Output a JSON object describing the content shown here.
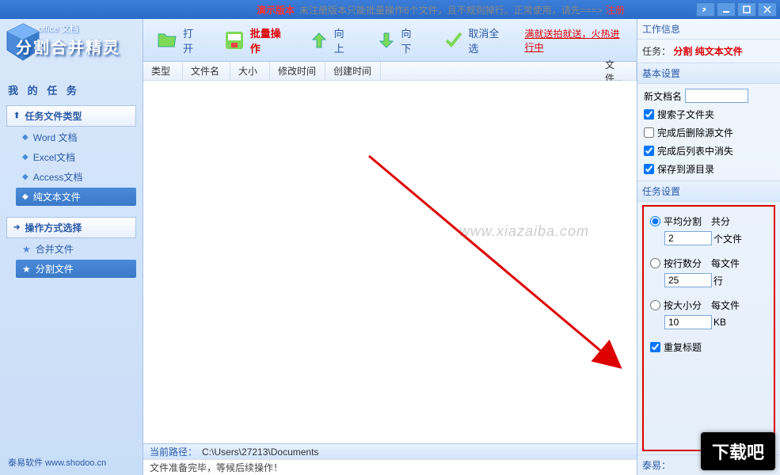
{
  "titlebar": {
    "demo_label": "演示版本",
    "demo_msg": "未注册版本只能批量操作6个文件，且不规则掉行。正常使用，请先===>",
    "register": "注册"
  },
  "logo": {
    "line1": "office 文档",
    "title": "分割合并精灵"
  },
  "sidebar": {
    "my_tasks": "我 的 任 务",
    "group1": "任务文件类型",
    "items1": [
      {
        "bullet": "◆",
        "label": "Word 文档"
      },
      {
        "bullet": "◆",
        "label": "Excel文档"
      },
      {
        "bullet": "◆",
        "label": "Access文档"
      },
      {
        "bullet": "◆",
        "label": "纯文本文件"
      }
    ],
    "group2": "操作方式选择",
    "items2": [
      {
        "bullet": "★",
        "label": "合并文件"
      },
      {
        "bullet": "★",
        "label": "分割文件"
      }
    ],
    "footer": "泰易软件 www.shodoo.cn"
  },
  "toolbar": {
    "open": "打开",
    "batch": "批量操作",
    "up": "向上",
    "down": "向下",
    "deselect": "取消全选",
    "promo": "满就送拍就送，火热进行中"
  },
  "columns": {
    "type": "类型",
    "name": "文件名",
    "size": "大小",
    "mtime": "修改时间",
    "ctime": "创建时间",
    "file": "文件..."
  },
  "watermark": "www.xiazaiba.com",
  "status": {
    "path_label": "当前路径：",
    "path_value": "C:\\Users\\27213\\Documents",
    "msg": "文件准备完毕，等候后续操作！"
  },
  "right": {
    "work_info": "工作信息",
    "task_label": "任务：",
    "task_value": "分割 纯文本文件",
    "basic_settings": "基本设置",
    "new_doc_name": "新文档名",
    "cb_search_sub": "搜索子文件夹",
    "cb_delete_after": "完成后删除源文件",
    "cb_remove_list": "完成后列表中消失",
    "cb_save_src": "保存到源目录",
    "task_settings": "任务设置",
    "split_avg": "平均分割",
    "split_avg_sufpre": "共分",
    "split_avg_val": "2",
    "split_avg_suf": "个文件",
    "split_rows": "按行数分",
    "split_rows_sufpre": "每文件",
    "split_rows_val": "25",
    "split_rows_suf": "行",
    "split_size": "按大小分",
    "split_size_sufpre": "每文件",
    "split_size_val": "10",
    "split_size_suf": "KB",
    "cb_repeat_title": "重复标题",
    "footer": "泰易："
  },
  "badge": "下载吧"
}
